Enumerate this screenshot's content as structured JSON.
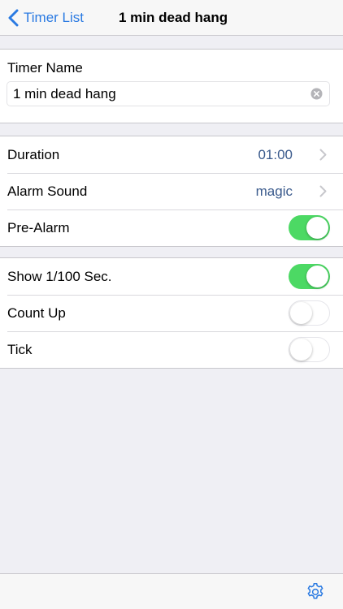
{
  "nav": {
    "back_label": "Timer List",
    "title": "1 min dead hang"
  },
  "name_section": {
    "label": "Timer Name",
    "value": "1 min dead hang"
  },
  "settings": {
    "duration": {
      "label": "Duration",
      "value": "01:00"
    },
    "alarm_sound": {
      "label": "Alarm Sound",
      "value": "magic"
    },
    "pre_alarm": {
      "label": "Pre-Alarm",
      "on": true
    }
  },
  "options": {
    "show_hundredths": {
      "label": "Show 1/100 Sec.",
      "on": true
    },
    "count_up": {
      "label": "Count Up",
      "on": false
    },
    "tick": {
      "label": "Tick",
      "on": false
    }
  },
  "toolbar": {
    "settings_icon": "gear-icon"
  },
  "colors": {
    "accent": "#2a7ae2",
    "value_text": "#3a5a8c",
    "toggle_on": "#4cd964",
    "background": "#efeff4"
  }
}
